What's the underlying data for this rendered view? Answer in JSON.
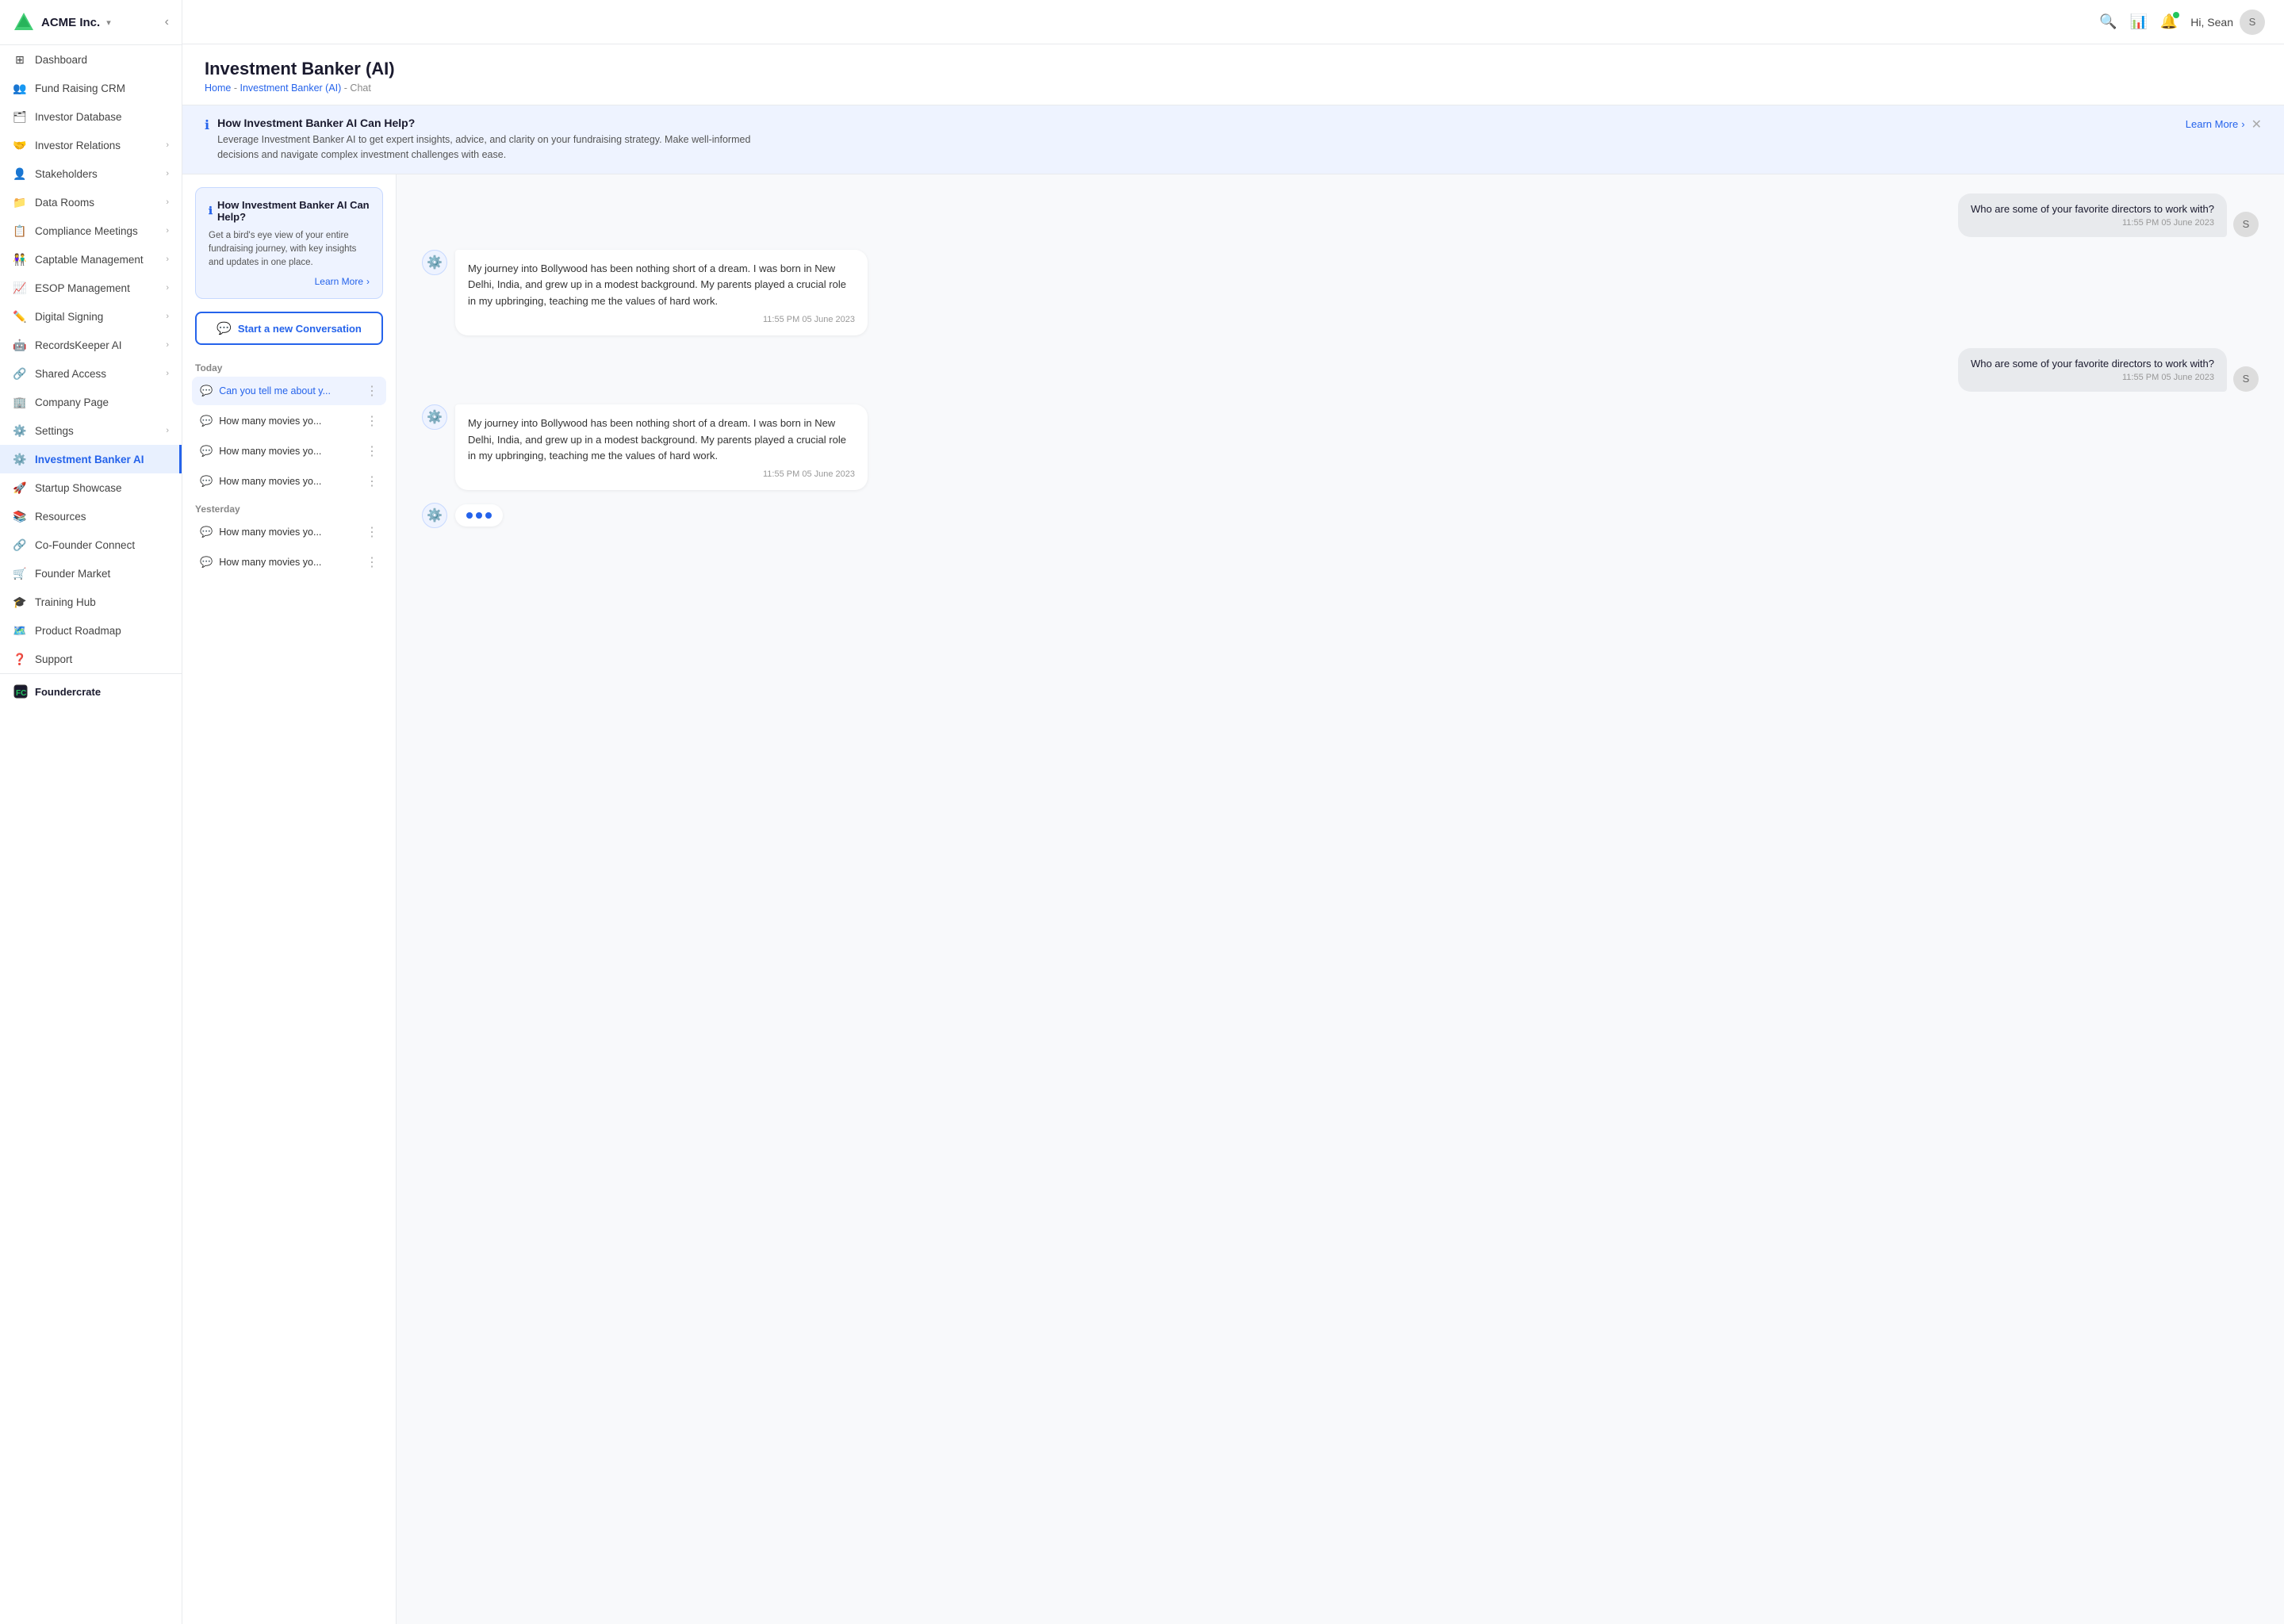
{
  "app": {
    "name": "ACME Inc.",
    "collapse_icon": "‹"
  },
  "topbar": {
    "user_greeting": "Hi, Sean",
    "search_icon": "🔍",
    "chart_icon": "📊",
    "bell_icon": "🔔"
  },
  "page": {
    "title": "Investment Banker (AI)",
    "breadcrumb_home": "Home",
    "breadcrumb_sep": " - ",
    "breadcrumb_section": "Investment Banker (AI)",
    "breadcrumb_current": "Chat"
  },
  "info_bar": {
    "title": "How Investment Banker AI Can Help?",
    "description": "Leverage Investment Banker AI to get expert insights, advice, and clarity on your fundraising strategy. Make well-informed decisions and navigate complex investment challenges with ease.",
    "learn_more": "Learn More"
  },
  "left_panel": {
    "banner_title": "How Investment Banker AI Can Help?",
    "banner_text": "Get a bird's eye view of your entire fundraising journey, with key insights and updates in one place.",
    "banner_link": "Learn More",
    "new_conv_btn": "Start a new Conversation",
    "today_label": "Today",
    "yesterday_label": "Yesterday",
    "conversations_today": [
      {
        "text": "Can you tell me about y..."
      },
      {
        "text": "How many movies yo..."
      },
      {
        "text": "How many movies yo..."
      },
      {
        "text": "How many movies yo..."
      }
    ],
    "conversations_yesterday": [
      {
        "text": "How many movies yo..."
      },
      {
        "text": "How many movies yo..."
      }
    ]
  },
  "chat": {
    "messages": [
      {
        "type": "user",
        "text": "Who are some of your favorite directors to work with?",
        "time": "11:55 PM 05 June 2023"
      },
      {
        "type": "ai",
        "text": "My journey into Bollywood has been nothing short of a dream. I was born in New Delhi, India, and grew up in a modest background. My parents played a crucial role in my upbringing, teaching me the values of hard work.",
        "time": "11:55 PM 05 June 2023"
      },
      {
        "type": "user",
        "text": "Who are some of your favorite directors to work with?",
        "time": "11:55 PM 05 June 2023"
      },
      {
        "type": "ai",
        "text": "My journey into Bollywood has been nothing short of a dream. I was born in New Delhi, India, and grew up in a modest background. My parents played a crucial role in my upbringing, teaching me the values of hard work.",
        "time": "11:55 PM 05 June 2023"
      },
      {
        "type": "typing"
      }
    ]
  },
  "sidebar": {
    "items": [
      {
        "id": "dashboard",
        "label": "Dashboard",
        "icon": "⊞",
        "has_chevron": false
      },
      {
        "id": "fundraising-crm",
        "label": "Fund Raising CRM",
        "icon": "👥",
        "has_chevron": false
      },
      {
        "id": "investor-database",
        "label": "Investor Database",
        "icon": "🗂",
        "has_chevron": false
      },
      {
        "id": "investor-relations",
        "label": "Investor Relations",
        "icon": "🤝",
        "has_chevron": true
      },
      {
        "id": "stakeholders",
        "label": "Stakeholders",
        "icon": "👤",
        "has_chevron": true
      },
      {
        "id": "data-rooms",
        "label": "Data Rooms",
        "icon": "📁",
        "has_chevron": true
      },
      {
        "id": "compliance-meetings",
        "label": "Compliance Meetings",
        "icon": "📋",
        "has_chevron": true
      },
      {
        "id": "captable-management",
        "label": "Captable Management",
        "icon": "📊",
        "has_chevron": true
      },
      {
        "id": "esop-management",
        "label": "ESOP Management",
        "icon": "📈",
        "has_chevron": true
      },
      {
        "id": "digital-signing",
        "label": "Digital Signing",
        "icon": "✍️",
        "has_chevron": true
      },
      {
        "id": "recordskeeper-ai",
        "label": "RecordsKeeper AI",
        "icon": "🤖",
        "has_chevron": true
      },
      {
        "id": "shared-access",
        "label": "Shared Access",
        "icon": "🔗",
        "has_chevron": true
      },
      {
        "id": "company-page",
        "label": "Company Page",
        "icon": "🏢",
        "has_chevron": false
      },
      {
        "id": "settings",
        "label": "Settings",
        "icon": "⚙️",
        "has_chevron": true
      },
      {
        "id": "investment-banker-ai",
        "label": "Investment Banker AI",
        "icon": "⚙️",
        "has_chevron": false,
        "active": true
      },
      {
        "id": "startup-showcase",
        "label": "Startup Showcase",
        "icon": "🚀",
        "has_chevron": false
      },
      {
        "id": "resources",
        "label": "Resources",
        "icon": "📚",
        "has_chevron": false
      },
      {
        "id": "co-founder-connect",
        "label": "Co-Founder Connect",
        "icon": "🔗",
        "has_chevron": false
      },
      {
        "id": "founder-market",
        "label": "Founder Market",
        "icon": "🛒",
        "has_chevron": false
      },
      {
        "id": "training-hub",
        "label": "Training Hub",
        "icon": "🎓",
        "has_chevron": false
      },
      {
        "id": "product-roadmap",
        "label": "Product Roadmap",
        "icon": "🗺️",
        "has_chevron": false
      },
      {
        "id": "support",
        "label": "Support",
        "icon": "❓",
        "has_chevron": false
      }
    ],
    "footer_brand": "Foundercrate"
  }
}
